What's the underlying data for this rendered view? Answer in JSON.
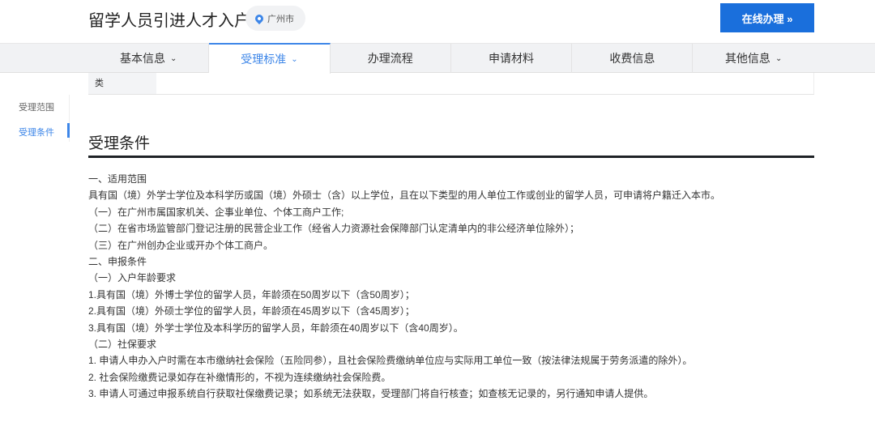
{
  "header": {
    "title": "留学人员引进人才入户",
    "location": "广州市",
    "online_button": "在线办理 »"
  },
  "tabs": [
    "基本信息",
    "受理标准",
    "办理流程",
    "申请材料",
    "收费信息",
    "其他信息"
  ],
  "table_cell": "类",
  "sidebar": [
    "受理范围",
    "受理条件"
  ],
  "section": {
    "title": "受理条件",
    "lines": [
      "一、适用范围",
      "具有国（境）外学士学位及本科学历或国（境）外硕士（含）以上学位，且在以下类型的用人单位工作或创业的留学人员，可申请将户籍迁入本市。",
      "（一）在广州市属国家机关、企事业单位、个体工商户工作;",
      "（二）在省市场监管部门登记注册的民营企业工作（经省人力资源社会保障部门认定清单内的非公经济单位除外）；",
      "（三）在广州创办企业或开办个体工商户。",
      "二、申报条件",
      "（一）入户年龄要求",
      "1.具有国（境）外博士学位的留学人员，年龄须在50周岁以下（含50周岁）；",
      "2.具有国（境）外硕士学位的留学人员，年龄须在45周岁以下（含45周岁）；",
      "3.具有国（境）外学士学位及本科学历的留学人员，年龄须在40周岁以下（含40周岁）。",
      "（二）社保要求",
      "1. 申请人申办入户时需在本市缴纳社会保险（五险同参），且社会保险费缴纳单位应与实际用工单位一致（按法律法规属于劳务派遣的除外）。",
      "2. 社会保险缴费记录如存在补缴情形的，不视为连续缴纳社会保险费。",
      "3. 申请人可通过申报系统自行获取社保缴费记录；如系统无法获取，受理部门将自行核查；如查核无记录的，另行通知申请人提供。"
    ]
  }
}
